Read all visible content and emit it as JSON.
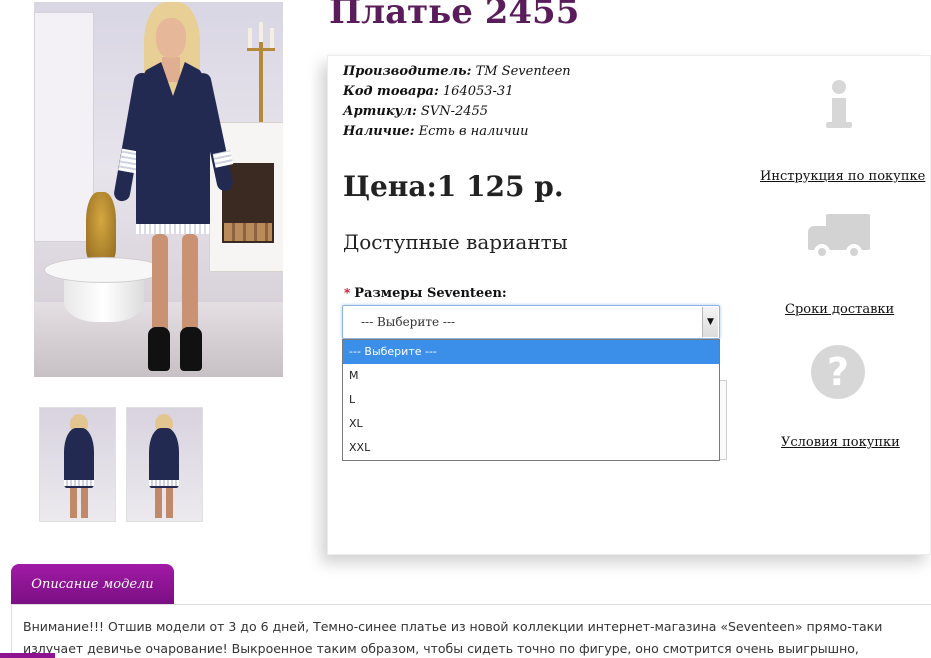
{
  "product": {
    "title": "Платье 2455",
    "manufacturer_label": "Производитель:",
    "manufacturer_value": "ТМ Seventeen",
    "code_label": "Код товара:",
    "code_value": "164053-31",
    "sku_label": "Артикул:",
    "sku_value": "SVN-2455",
    "availability_label": "Наличие:",
    "availability_value": "Есть в наличии",
    "price_label": "Цена:",
    "price_value": "1 125 р."
  },
  "variants": {
    "title": "Доступные варианты",
    "required_mark": "*",
    "size_label": "Размеры Seventeen:",
    "selected": "--- Выберите ---",
    "options": [
      "--- Выберите ---",
      "M",
      "L",
      "XL",
      "XXL"
    ]
  },
  "side_links": {
    "instruction": "Инструкция по покупке",
    "delivery": "Сроки доставки",
    "conditions": "Условия покупки"
  },
  "description": {
    "tab_label": "Описание модели",
    "text": "Внимание!!! Отшив модели от 3 до 6 дней, Темно-синее платье из новой коллекции интернет-магазина «Seventeen» прямо-таки излучает девичье очарование! Выкроенное таким образом, чтобы сидеть точно по фигуре, оно смотрится очень выигрышно,"
  },
  "icons": {
    "info": "info-icon",
    "delivery": "truck-icon",
    "conditions": "question-icon",
    "select_arrow": "▼"
  },
  "colors": {
    "title": "#5a1c5a",
    "tab": "#8d1390",
    "dropdown_highlight": "#3b8fe8"
  }
}
